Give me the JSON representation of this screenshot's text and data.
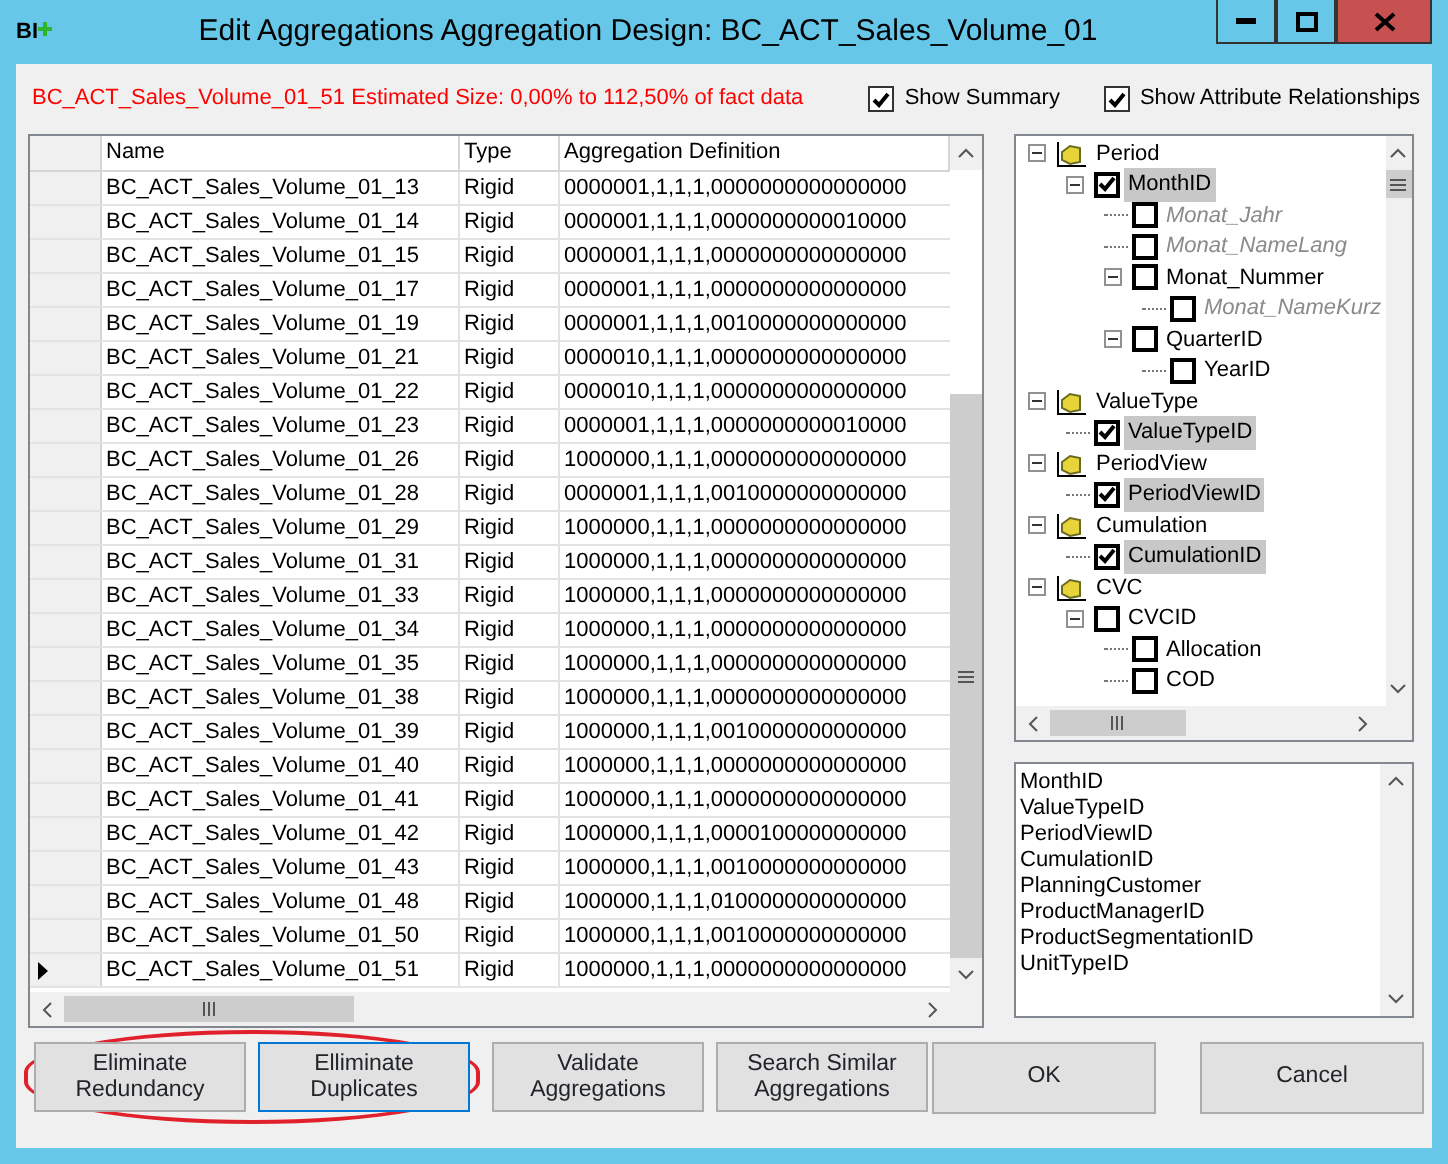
{
  "window": {
    "app_icon_text": "BI",
    "title": "Edit Aggregations Aggregation Design: BC_ACT_Sales_Volume_01"
  },
  "estimate": "BC_ACT_Sales_Volume_01_51 Estimated Size: 0,00% to 112,50% of fact data",
  "options": [
    {
      "label": "Show Summary",
      "checked": true
    },
    {
      "label": "Show Attribute Relationships",
      "checked": true
    }
  ],
  "table": {
    "columns": [
      "Name",
      "Type",
      "Aggregation Definition"
    ],
    "rows": [
      {
        "name": "BC_ACT_Sales_Volume_01_13",
        "type": "Rigid",
        "definition": "0000001,1,1,1,0000000000000000",
        "current": false
      },
      {
        "name": "BC_ACT_Sales_Volume_01_14",
        "type": "Rigid",
        "definition": "0000001,1,1,1,0000000000010000",
        "current": false
      },
      {
        "name": "BC_ACT_Sales_Volume_01_15",
        "type": "Rigid",
        "definition": "0000001,1,1,1,0000000000000000",
        "current": false
      },
      {
        "name": "BC_ACT_Sales_Volume_01_17",
        "type": "Rigid",
        "definition": "0000001,1,1,1,0000000000000000",
        "current": false
      },
      {
        "name": "BC_ACT_Sales_Volume_01_19",
        "type": "Rigid",
        "definition": "0000001,1,1,1,0010000000000000",
        "current": false
      },
      {
        "name": "BC_ACT_Sales_Volume_01_21",
        "type": "Rigid",
        "definition": "0000010,1,1,1,0000000000000000",
        "current": false
      },
      {
        "name": "BC_ACT_Sales_Volume_01_22",
        "type": "Rigid",
        "definition": "0000010,1,1,1,0000000000000000",
        "current": false
      },
      {
        "name": "BC_ACT_Sales_Volume_01_23",
        "type": "Rigid",
        "definition": "0000001,1,1,1,0000000000010000",
        "current": false
      },
      {
        "name": "BC_ACT_Sales_Volume_01_26",
        "type": "Rigid",
        "definition": "1000000,1,1,1,0000000000000000",
        "current": false
      },
      {
        "name": "BC_ACT_Sales_Volume_01_28",
        "type": "Rigid",
        "definition": "0000001,1,1,1,0010000000000000",
        "current": false
      },
      {
        "name": "BC_ACT_Sales_Volume_01_29",
        "type": "Rigid",
        "definition": "1000000,1,1,1,0000000000000000",
        "current": false
      },
      {
        "name": "BC_ACT_Sales_Volume_01_31",
        "type": "Rigid",
        "definition": "1000000,1,1,1,0000000000000000",
        "current": false
      },
      {
        "name": "BC_ACT_Sales_Volume_01_33",
        "type": "Rigid",
        "definition": "1000000,1,1,1,0000000000000000",
        "current": false
      },
      {
        "name": "BC_ACT_Sales_Volume_01_34",
        "type": "Rigid",
        "definition": "1000000,1,1,1,0000000000000000",
        "current": false
      },
      {
        "name": "BC_ACT_Sales_Volume_01_35",
        "type": "Rigid",
        "definition": "1000000,1,1,1,0000000000000000",
        "current": false
      },
      {
        "name": "BC_ACT_Sales_Volume_01_38",
        "type": "Rigid",
        "definition": "1000000,1,1,1,0000000000000000",
        "current": false
      },
      {
        "name": "BC_ACT_Sales_Volume_01_39",
        "type": "Rigid",
        "definition": "1000000,1,1,1,0010000000000000",
        "current": false
      },
      {
        "name": "BC_ACT_Sales_Volume_01_40",
        "type": "Rigid",
        "definition": "1000000,1,1,1,0000000000000000",
        "current": false
      },
      {
        "name": "BC_ACT_Sales_Volume_01_41",
        "type": "Rigid",
        "definition": "1000000,1,1,1,0000000000000000",
        "current": false
      },
      {
        "name": "BC_ACT_Sales_Volume_01_42",
        "type": "Rigid",
        "definition": "1000000,1,1,1,0000100000000000",
        "current": false
      },
      {
        "name": "BC_ACT_Sales_Volume_01_43",
        "type": "Rigid",
        "definition": "1000000,1,1,1,0010000000000000",
        "current": false
      },
      {
        "name": "BC_ACT_Sales_Volume_01_48",
        "type": "Rigid",
        "definition": "1000000,1,1,1,0100000000000000",
        "current": false
      },
      {
        "name": "BC_ACT_Sales_Volume_01_50",
        "type": "Rigid",
        "definition": "1000000,1,1,1,0010000000000000",
        "current": false
      },
      {
        "name": "BC_ACT_Sales_Volume_01_51",
        "type": "Rigid",
        "definition": "1000000,1,1,1,0000000000000000",
        "current": true
      }
    ]
  },
  "tree": [
    {
      "kind": "dimension",
      "label": "Period",
      "expanded": true,
      "children": [
        {
          "kind": "attribute",
          "label": "MonthID",
          "checked": true,
          "dimmed": false,
          "expanded": true,
          "children": [
            {
              "kind": "attribute",
              "label": "Monat_Jahr",
              "checked": false,
              "dimmed": true
            },
            {
              "kind": "attribute",
              "label": "Monat_NameLang",
              "checked": false,
              "dimmed": true
            },
            {
              "kind": "attribute",
              "label": "Monat_Nummer",
              "checked": false,
              "dimmed": false,
              "expanded": true,
              "children": [
                {
                  "kind": "attribute",
                  "label": "Monat_NameKurz",
                  "checked": false,
                  "dimmed": true
                }
              ]
            },
            {
              "kind": "attribute",
              "label": "QuarterID",
              "checked": false,
              "dimmed": false,
              "expanded": true,
              "children": [
                {
                  "kind": "attribute",
                  "label": "YearID",
                  "checked": false,
                  "dimmed": false
                }
              ]
            }
          ]
        }
      ]
    },
    {
      "kind": "dimension",
      "label": "ValueType",
      "expanded": true,
      "children": [
        {
          "kind": "attribute",
          "label": "ValueTypeID",
          "checked": true,
          "dimmed": false
        }
      ]
    },
    {
      "kind": "dimension",
      "label": "PeriodView",
      "expanded": true,
      "children": [
        {
          "kind": "attribute",
          "label": "PeriodViewID",
          "checked": true,
          "dimmed": false
        }
      ]
    },
    {
      "kind": "dimension",
      "label": "Cumulation",
      "expanded": true,
      "children": [
        {
          "kind": "attribute",
          "label": "CumulationID",
          "checked": true,
          "dimmed": false
        }
      ]
    },
    {
      "kind": "dimension",
      "label": "CVC",
      "expanded": true,
      "children": [
        {
          "kind": "attribute",
          "label": "CVCID",
          "checked": false,
          "dimmed": false,
          "expanded": true,
          "children": [
            {
              "kind": "attribute",
              "label": "Allocation",
              "checked": false,
              "dimmed": false
            },
            {
              "kind": "attribute",
              "label": "COD",
              "checked": false,
              "dimmed": false
            }
          ]
        }
      ]
    }
  ],
  "summary": [
    "MonthID",
    "ValueTypeID",
    "PeriodViewID",
    "CumulationID",
    "PlanningCustomer",
    "ProductManagerID",
    "ProductSegmentationID",
    "UnitTypeID"
  ],
  "buttons": [
    {
      "label": "Eliminate\nRedundancy",
      "circled": true,
      "focused": false
    },
    {
      "label": "Elliminate\nDuplicates",
      "circled": true,
      "focused": true
    },
    {
      "label": "Validate\nAggregations",
      "circled": false,
      "focused": false
    },
    {
      "label": "Search Similar\nAggregations",
      "circled": false,
      "focused": false
    }
  ],
  "dialog_buttons": [
    "OK",
    "Cancel"
  ]
}
